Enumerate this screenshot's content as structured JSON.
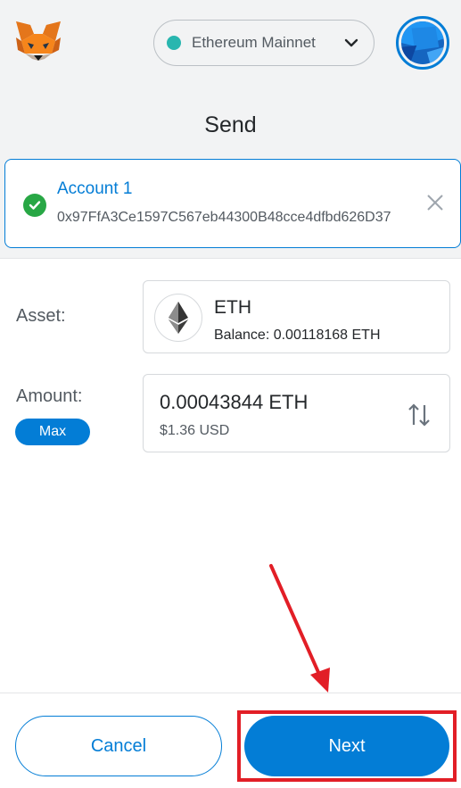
{
  "header": {
    "network_label": "Ethereum Mainnet",
    "network_color": "#29b6af",
    "logo_icon": "metamask-fox-icon",
    "avatar_icon": "account-identicon-icon"
  },
  "page": {
    "title": "Send"
  },
  "account": {
    "name": "Account 1",
    "address": "0x97FfA3Ce1597C567eb44300B48cce4dfbd626D37"
  },
  "asset": {
    "label": "Asset:",
    "symbol": "ETH",
    "balance": "Balance:  0.00118168 ETH"
  },
  "amount": {
    "label": "Amount:",
    "max_label": "Max",
    "value": "0.00043844  ETH",
    "usd": "$1.36 USD"
  },
  "footer": {
    "cancel_label": "Cancel",
    "next_label": "Next"
  },
  "colors": {
    "accent": "#037dd6",
    "highlight": "#e21e26",
    "success": "#28a745"
  }
}
